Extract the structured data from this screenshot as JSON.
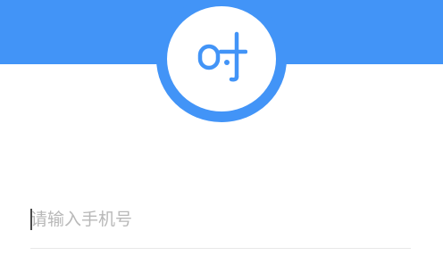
{
  "brand": {
    "logo_text": "时",
    "accent_color": "#4294f7",
    "icon": "app-logo-icon"
  },
  "login": {
    "phone_placeholder": "请输入手机号",
    "phone_value": ""
  }
}
